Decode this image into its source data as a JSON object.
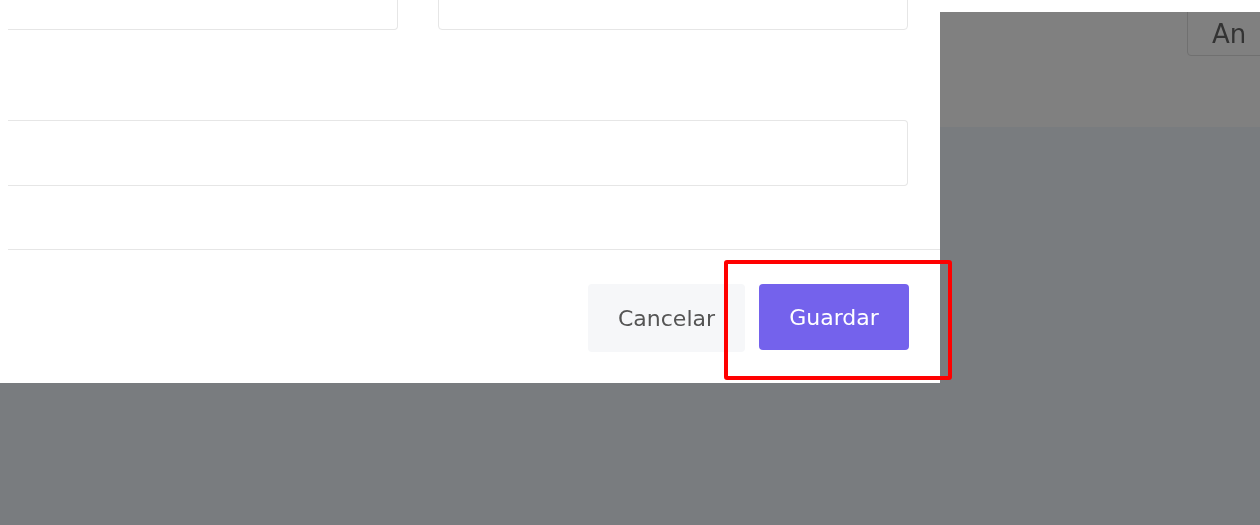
{
  "background_button": {
    "label": "An"
  },
  "modal": {
    "buttons": [
      {
        "label": "Cancelar",
        "kind": "secondary"
      },
      {
        "label": "Guardar",
        "kind": "primary"
      }
    ]
  }
}
